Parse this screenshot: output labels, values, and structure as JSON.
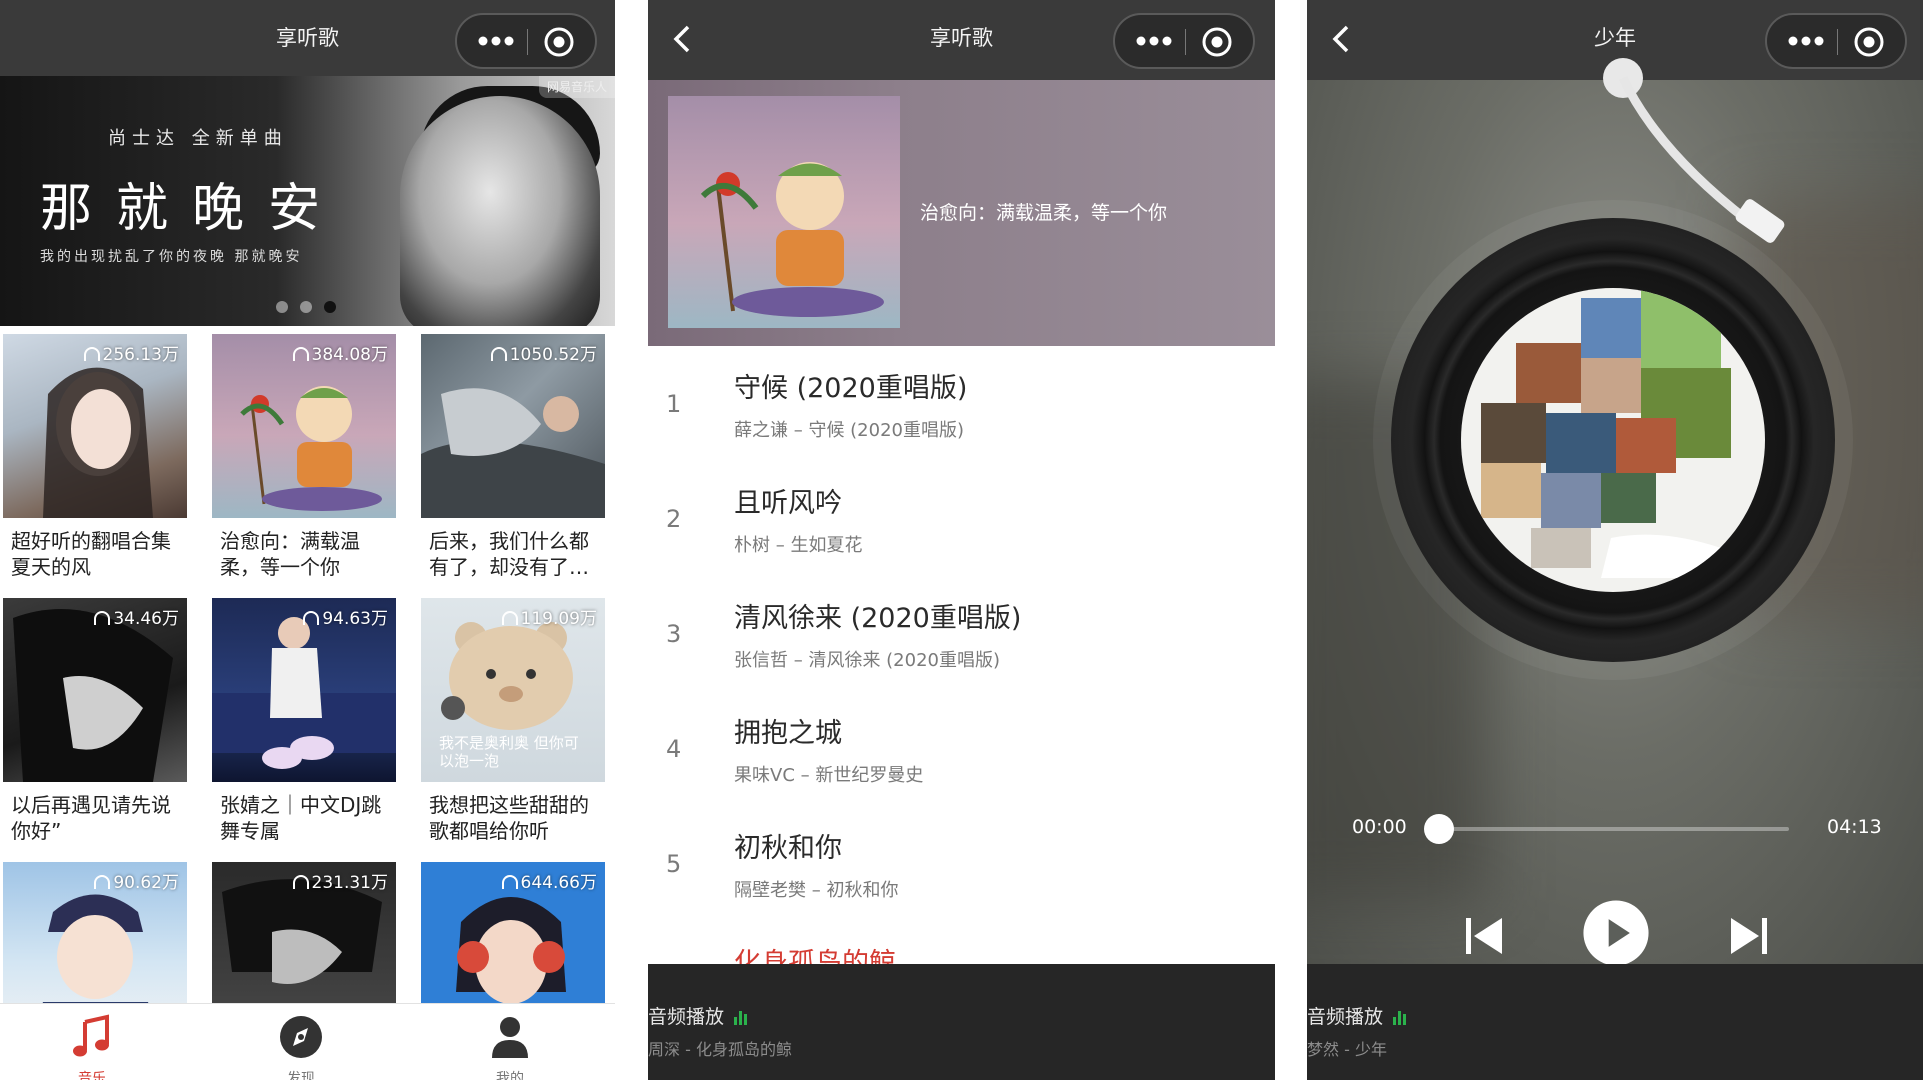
{
  "home": {
    "nav_title": "享听歌",
    "banner": {
      "tag": "网易音乐人",
      "subtitle": "尚士达 全新单曲",
      "headline": "那就晚安",
      "tagline": "我的出现扰乱了你的夜晚 那就晚安",
      "dot_count": 3,
      "active_dot": 3
    },
    "playlists": [
      {
        "count": "256.13万",
        "name": "超好听的翻唱合集夏天的风"
      },
      {
        "count": "384.08万",
        "name": "治愈向：满载温柔，等一个你"
      },
      {
        "count": "1050.52万",
        "name": "后来，我们什么都有了，却没有了…"
      },
      {
        "count": "34.46万",
        "name": "以后再遇见请先说你好”"
      },
      {
        "count": "94.63万",
        "name": "张婧之｜中文DJ跳舞专属"
      },
      {
        "count": "119.09万",
        "name": "我想把这些甜甜的歌都唱给你听",
        "cover_text": "我不是奥利奥 但你可以泡一泡"
      },
      {
        "count": "90.62万",
        "name": ""
      },
      {
        "count": "231.31万",
        "name": ""
      },
      {
        "count": "644.66万",
        "name": ""
      }
    ],
    "tabs": [
      {
        "label": "音乐",
        "icon": "music-note-icon",
        "active": true
      },
      {
        "label": "发现",
        "icon": "compass-icon",
        "active": false
      },
      {
        "label": "我的",
        "icon": "user-icon",
        "active": false
      }
    ]
  },
  "playlist_page": {
    "nav_title": "享听歌",
    "description": "治愈向：满载温柔，等一个你",
    "songs": [
      {
        "index": "1",
        "title": "守候 (2020重唱版)",
        "meta": "薛之谦 – 守候 (2020重唱版)"
      },
      {
        "index": "2",
        "title": "且听风吟",
        "meta": "朴树 – 生如夏花"
      },
      {
        "index": "3",
        "title": "清风徐来 (2020重唱版)",
        "meta": "张信哲 – 清风徐来 (2020重唱版)"
      },
      {
        "index": "4",
        "title": "拥抱之城",
        "meta": "果味VC – 新世纪罗曼史"
      },
      {
        "index": "5",
        "title": "初秋和你",
        "meta": "隔壁老樊 – 初秋和你"
      },
      {
        "index": "",
        "title": "化身孤岛的鲸",
        "meta": ""
      }
    ],
    "mini_player": {
      "label": "音频播放",
      "subtitle": "周深 - 化身孤岛的鲸"
    }
  },
  "player_page": {
    "nav_title": "少年",
    "current_time": "00:00",
    "duration": "04:13",
    "progress_fraction": 0.0,
    "mini_player": {
      "label": "音频播放",
      "subtitle": "梦然 - 少年"
    }
  },
  "colors": {
    "accent_red": "#d43c33",
    "nav_bg": "#3a3a3a",
    "eq_green": "#2bb24c"
  }
}
